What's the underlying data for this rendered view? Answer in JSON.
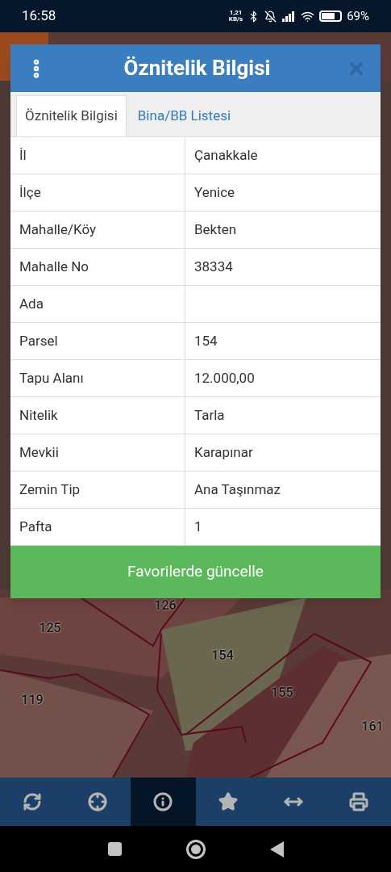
{
  "status_bar": {
    "time": "16:58",
    "speed": "1,21",
    "speed_unit": "KB/s",
    "battery": "69%"
  },
  "map_labels": [
    "126",
    "125",
    "154",
    "119",
    "155",
    "161"
  ],
  "dialog": {
    "title": "Öznitelik Bilgisi",
    "tabs": [
      {
        "label": "Öznitelik Bilgisi",
        "selected": true
      },
      {
        "label": "Bina/BB Listesi",
        "selected": false
      }
    ],
    "rows": [
      {
        "field": "İl",
        "value": "Çanakkale"
      },
      {
        "field": "İlçe",
        "value": "Yenice"
      },
      {
        "field": "Mahalle/Köy",
        "value": "Bekten"
      },
      {
        "field": "Mahalle No",
        "value": "38334"
      },
      {
        "field": "Ada"
      },
      {
        "field": "Parsel",
        "value": "154"
      },
      {
        "field": "Tapu Alanı",
        "value": "12.000,00"
      },
      {
        "field": "Nitelik",
        "value": "Tarla"
      },
      {
        "field": "Mevkii",
        "value": "Karapınar"
      },
      {
        "field": "Zemin Tip",
        "value": "Ana Taşınmaz"
      },
      {
        "field": "Pafta",
        "value": "1"
      }
    ],
    "button": "Favorilerde güncelle"
  },
  "toolbar": [
    {
      "kind": "refresh",
      "selected": false
    },
    {
      "kind": "locate",
      "selected": false
    },
    {
      "kind": "info",
      "selected": true
    },
    {
      "kind": "favorite",
      "selected": false
    },
    {
      "kind": "measure",
      "selected": false
    },
    {
      "kind": "print",
      "selected": false
    }
  ]
}
